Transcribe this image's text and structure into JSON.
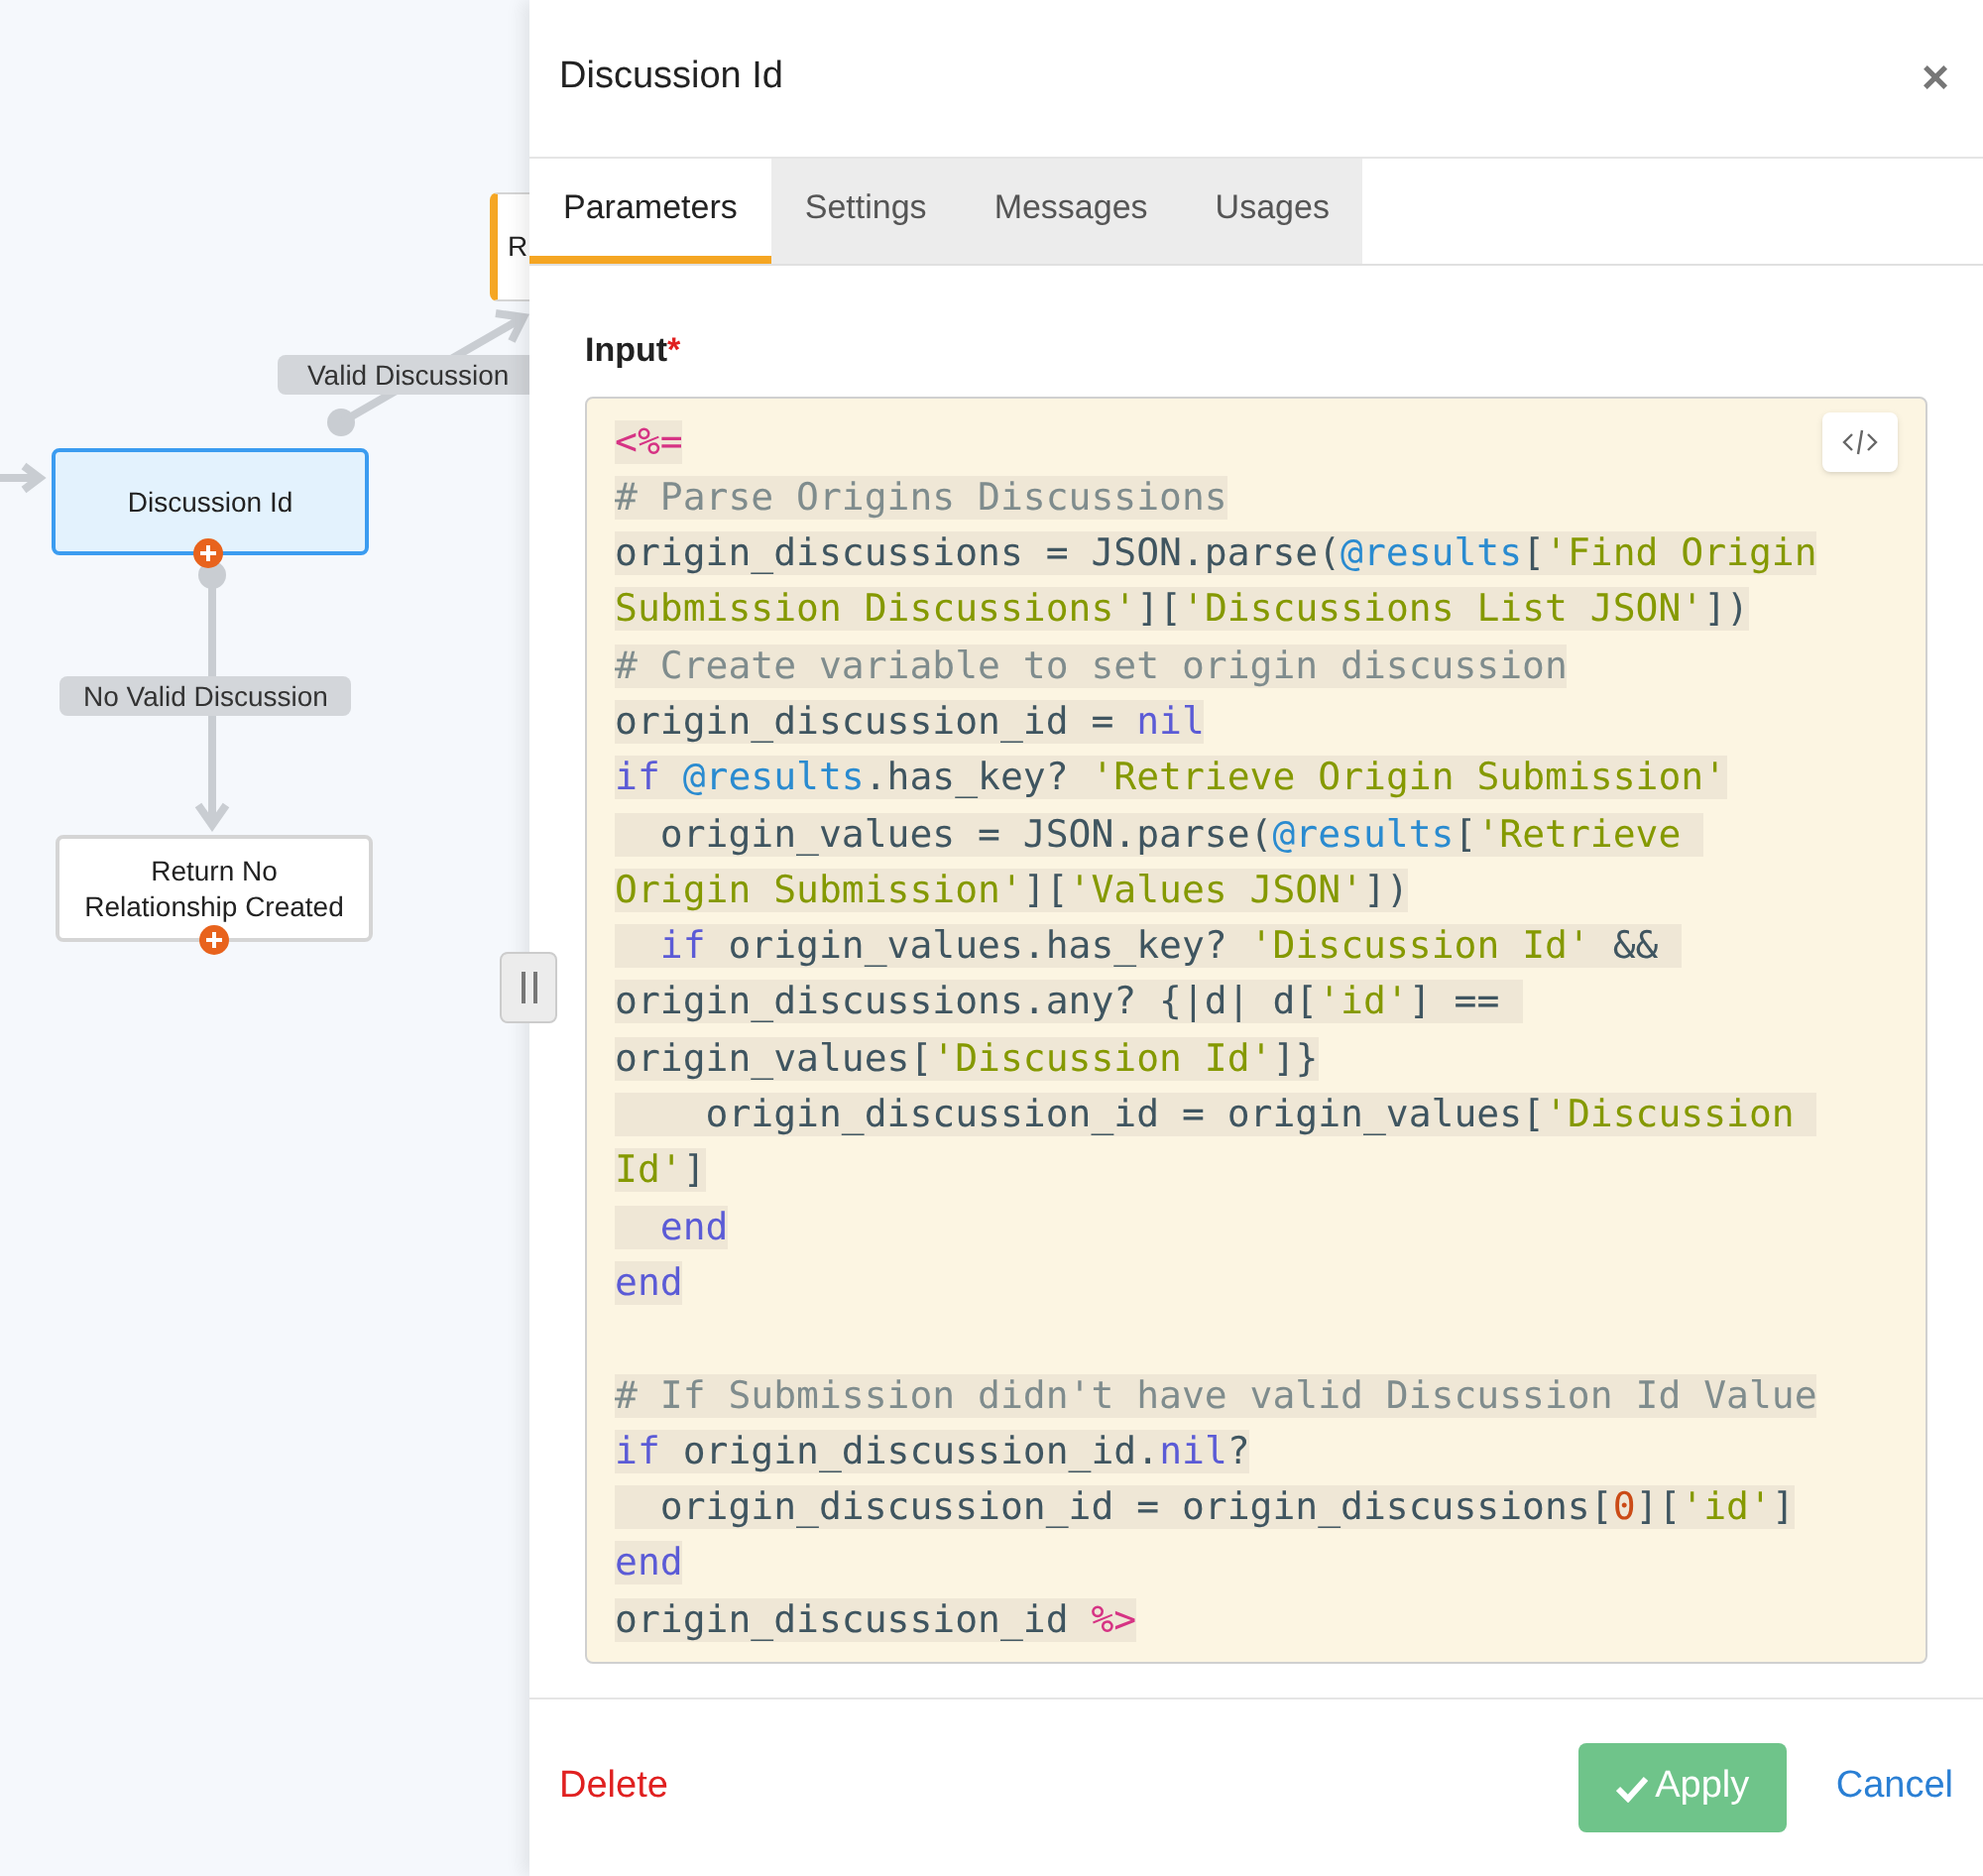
{
  "canvas": {
    "nodes": [
      {
        "kind": "partial",
        "label": "R",
        "selected": false
      },
      {
        "kind": "node",
        "label": "Discussion Id",
        "selected": true
      },
      {
        "kind": "node",
        "label": "Return No Relationship Created",
        "selected": false
      }
    ],
    "edges": [
      {
        "label": "Valid Discussion"
      },
      {
        "label": "No Valid Discussion"
      }
    ]
  },
  "panel": {
    "title": "Discussion Id",
    "close": "×",
    "tabs": [
      {
        "label": "Parameters",
        "selected": true
      },
      {
        "label": "Settings",
        "selected": false
      },
      {
        "label": "Messages",
        "selected": false
      },
      {
        "label": "Usages",
        "selected": false
      }
    ],
    "field": {
      "label": "Input",
      "required": true,
      "required_mark": "*",
      "code_lines": [
        {
          "tokens": [
            {
              "kind": "erb",
              "text": "<%="
            }
          ]
        },
        {
          "tokens": [
            {
              "kind": "comment",
              "text": "# Parse Origins Discussions"
            }
          ]
        },
        {
          "tokens": [
            {
              "kind": "plain",
              "text": "origin_discussions = JSON.parse("
            },
            {
              "kind": "ivar",
              "text": "@results"
            },
            {
              "kind": "plain",
              "text": "["
            },
            {
              "kind": "string",
              "text": "'Find Origin"
            }
          ]
        },
        {
          "tokens": [
            {
              "kind": "string",
              "text": "Submission Discussions'"
            },
            {
              "kind": "plain",
              "text": "]["
            },
            {
              "kind": "string",
              "text": "'Discussions List JSON'"
            },
            {
              "kind": "plain",
              "text": "])"
            }
          ]
        },
        {
          "tokens": [
            {
              "kind": "comment",
              "text": "# Create variable to set origin discussion"
            }
          ]
        },
        {
          "tokens": [
            {
              "kind": "plain",
              "text": "origin_discussion_id = "
            },
            {
              "kind": "keyword",
              "text": "nil"
            }
          ]
        },
        {
          "tokens": [
            {
              "kind": "keyword",
              "text": "if "
            },
            {
              "kind": "ivar",
              "text": "@results"
            },
            {
              "kind": "plain",
              "text": ".has_key? "
            },
            {
              "kind": "string",
              "text": "'Retrieve Origin Submission'"
            }
          ]
        },
        {
          "tokens": [
            {
              "kind": "plain",
              "text": "  origin_values = JSON.parse("
            },
            {
              "kind": "ivar",
              "text": "@results"
            },
            {
              "kind": "plain",
              "text": "["
            },
            {
              "kind": "string",
              "text": "'Retrieve "
            }
          ]
        },
        {
          "tokens": [
            {
              "kind": "string",
              "text": "Origin Submission'"
            },
            {
              "kind": "plain",
              "text": "]["
            },
            {
              "kind": "string",
              "text": "'Values JSON'"
            },
            {
              "kind": "plain",
              "text": "])"
            }
          ]
        },
        {
          "tokens": [
            {
              "kind": "keyword",
              "text": "  if"
            },
            {
              "kind": "plain",
              "text": " origin_values.has_key? "
            },
            {
              "kind": "string",
              "text": "'Discussion Id'"
            },
            {
              "kind": "plain",
              "text": " && "
            }
          ]
        },
        {
          "tokens": [
            {
              "kind": "plain",
              "text": "origin_discussions.any? {|d| d["
            },
            {
              "kind": "string",
              "text": "'id'"
            },
            {
              "kind": "plain",
              "text": "] == "
            }
          ]
        },
        {
          "tokens": [
            {
              "kind": "plain",
              "text": "origin_values["
            },
            {
              "kind": "string",
              "text": "'Discussion Id'"
            },
            {
              "kind": "plain",
              "text": "]}"
            }
          ]
        },
        {
          "tokens": [
            {
              "kind": "plain",
              "text": "    origin_discussion_id = origin_values["
            },
            {
              "kind": "string",
              "text": "'Discussion "
            }
          ]
        },
        {
          "tokens": [
            {
              "kind": "string",
              "text": "Id'"
            },
            {
              "kind": "plain",
              "text": "]"
            }
          ]
        },
        {
          "tokens": [
            {
              "kind": "keyword",
              "text": "  end"
            }
          ]
        },
        {
          "tokens": [
            {
              "kind": "keyword",
              "text": "end"
            }
          ]
        },
        {
          "kind": "blank"
        },
        {
          "tokens": [
            {
              "kind": "comment",
              "text": "# If Submission didn't have valid Discussion Id Value"
            }
          ]
        },
        {
          "tokens": [
            {
              "kind": "keyword",
              "text": "if"
            },
            {
              "kind": "plain",
              "text": " origin_discussion_id."
            },
            {
              "kind": "keyword",
              "text": "nil"
            },
            {
              "kind": "plain",
              "text": "?"
            }
          ]
        },
        {
          "tokens": [
            {
              "kind": "plain",
              "text": "  origin_discussion_id = origin_discussions["
            },
            {
              "kind": "number",
              "text": "0"
            },
            {
              "kind": "plain",
              "text": "]["
            },
            {
              "kind": "string",
              "text": "'id'"
            },
            {
              "kind": "plain",
              "text": "]"
            }
          ]
        },
        {
          "tokens": [
            {
              "kind": "keyword",
              "text": "end"
            }
          ]
        },
        {
          "tokens": [
            {
              "kind": "plain",
              "text": "origin_discussion_id "
            },
            {
              "kind": "erb",
              "text": "%>"
            }
          ]
        }
      ]
    },
    "footer": {
      "delete": "Delete",
      "apply": "Apply",
      "cancel": "Cancel"
    }
  }
}
